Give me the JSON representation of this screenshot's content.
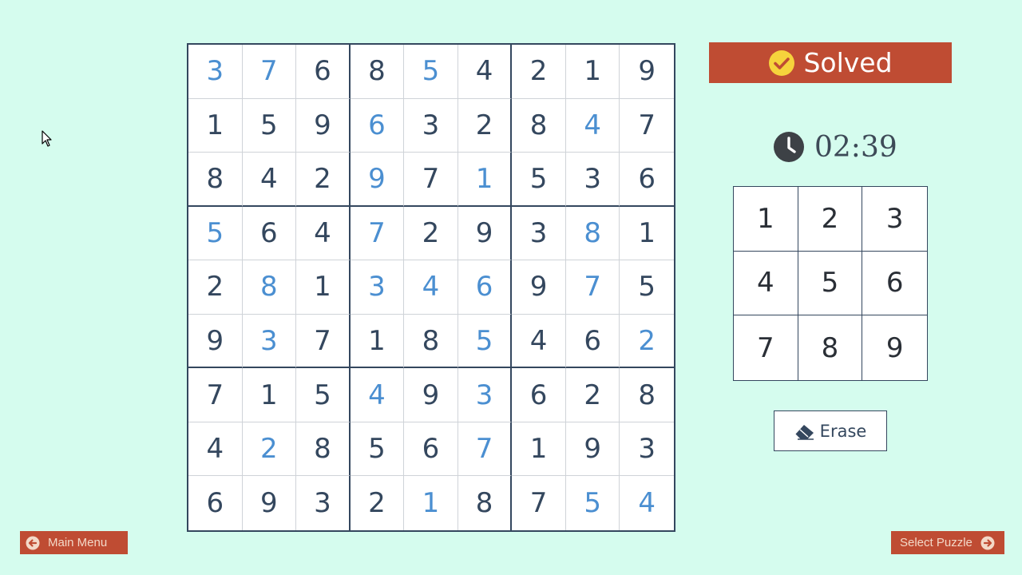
{
  "status": {
    "label": "Solved",
    "icon": "check-circle-icon",
    "color": "#bf4c33"
  },
  "timer": {
    "icon": "clock-icon",
    "value": "02:39"
  },
  "board": {
    "given_color": "#34475e",
    "entered_color": "#4b8fd1",
    "rows": [
      [
        {
          "v": "3",
          "e": true
        },
        {
          "v": "7",
          "e": true
        },
        {
          "v": "6",
          "e": false
        },
        {
          "v": "8",
          "e": false
        },
        {
          "v": "5",
          "e": true
        },
        {
          "v": "4",
          "e": false
        },
        {
          "v": "2",
          "e": false
        },
        {
          "v": "1",
          "e": false
        },
        {
          "v": "9",
          "e": false
        }
      ],
      [
        {
          "v": "1",
          "e": false
        },
        {
          "v": "5",
          "e": false
        },
        {
          "v": "9",
          "e": false
        },
        {
          "v": "6",
          "e": true
        },
        {
          "v": "3",
          "e": false
        },
        {
          "v": "2",
          "e": false
        },
        {
          "v": "8",
          "e": false
        },
        {
          "v": "4",
          "e": true
        },
        {
          "v": "7",
          "e": false
        }
      ],
      [
        {
          "v": "8",
          "e": false
        },
        {
          "v": "4",
          "e": false
        },
        {
          "v": "2",
          "e": false
        },
        {
          "v": "9",
          "e": true
        },
        {
          "v": "7",
          "e": false
        },
        {
          "v": "1",
          "e": true
        },
        {
          "v": "5",
          "e": false
        },
        {
          "v": "3",
          "e": false
        },
        {
          "v": "6",
          "e": false
        }
      ],
      [
        {
          "v": "5",
          "e": true
        },
        {
          "v": "6",
          "e": false
        },
        {
          "v": "4",
          "e": false
        },
        {
          "v": "7",
          "e": true
        },
        {
          "v": "2",
          "e": false
        },
        {
          "v": "9",
          "e": false
        },
        {
          "v": "3",
          "e": false
        },
        {
          "v": "8",
          "e": true
        },
        {
          "v": "1",
          "e": false
        }
      ],
      [
        {
          "v": "2",
          "e": false
        },
        {
          "v": "8",
          "e": true
        },
        {
          "v": "1",
          "e": false
        },
        {
          "v": "3",
          "e": true
        },
        {
          "v": "4",
          "e": true
        },
        {
          "v": "6",
          "e": true
        },
        {
          "v": "9",
          "e": false
        },
        {
          "v": "7",
          "e": true
        },
        {
          "v": "5",
          "e": false
        }
      ],
      [
        {
          "v": "9",
          "e": false
        },
        {
          "v": "3",
          "e": true
        },
        {
          "v": "7",
          "e": false
        },
        {
          "v": "1",
          "e": false
        },
        {
          "v": "8",
          "e": false
        },
        {
          "v": "5",
          "e": true
        },
        {
          "v": "4",
          "e": false
        },
        {
          "v": "6",
          "e": false
        },
        {
          "v": "2",
          "e": true
        }
      ],
      [
        {
          "v": "7",
          "e": false
        },
        {
          "v": "1",
          "e": false
        },
        {
          "v": "5",
          "e": false
        },
        {
          "v": "4",
          "e": true
        },
        {
          "v": "9",
          "e": false
        },
        {
          "v": "3",
          "e": true
        },
        {
          "v": "6",
          "e": false
        },
        {
          "v": "2",
          "e": false
        },
        {
          "v": "8",
          "e": false
        }
      ],
      [
        {
          "v": "4",
          "e": false
        },
        {
          "v": "2",
          "e": true
        },
        {
          "v": "8",
          "e": false
        },
        {
          "v": "5",
          "e": false
        },
        {
          "v": "6",
          "e": false
        },
        {
          "v": "7",
          "e": true
        },
        {
          "v": "1",
          "e": false
        },
        {
          "v": "9",
          "e": false
        },
        {
          "v": "3",
          "e": false
        }
      ],
      [
        {
          "v": "6",
          "e": false
        },
        {
          "v": "9",
          "e": false
        },
        {
          "v": "3",
          "e": false
        },
        {
          "v": "2",
          "e": false
        },
        {
          "v": "1",
          "e": true
        },
        {
          "v": "8",
          "e": false
        },
        {
          "v": "7",
          "e": false
        },
        {
          "v": "5",
          "e": true
        },
        {
          "v": "4",
          "e": true
        }
      ]
    ]
  },
  "numpad": {
    "keys": [
      "1",
      "2",
      "3",
      "4",
      "5",
      "6",
      "7",
      "8",
      "9"
    ]
  },
  "erase": {
    "label": "Erase",
    "icon": "eraser-icon"
  },
  "nav": {
    "main_menu": {
      "label": "Main Menu",
      "icon": "arrow-left-circle-icon"
    },
    "select_puzzle": {
      "label": "Select Puzzle",
      "icon": "arrow-right-circle-icon"
    }
  }
}
